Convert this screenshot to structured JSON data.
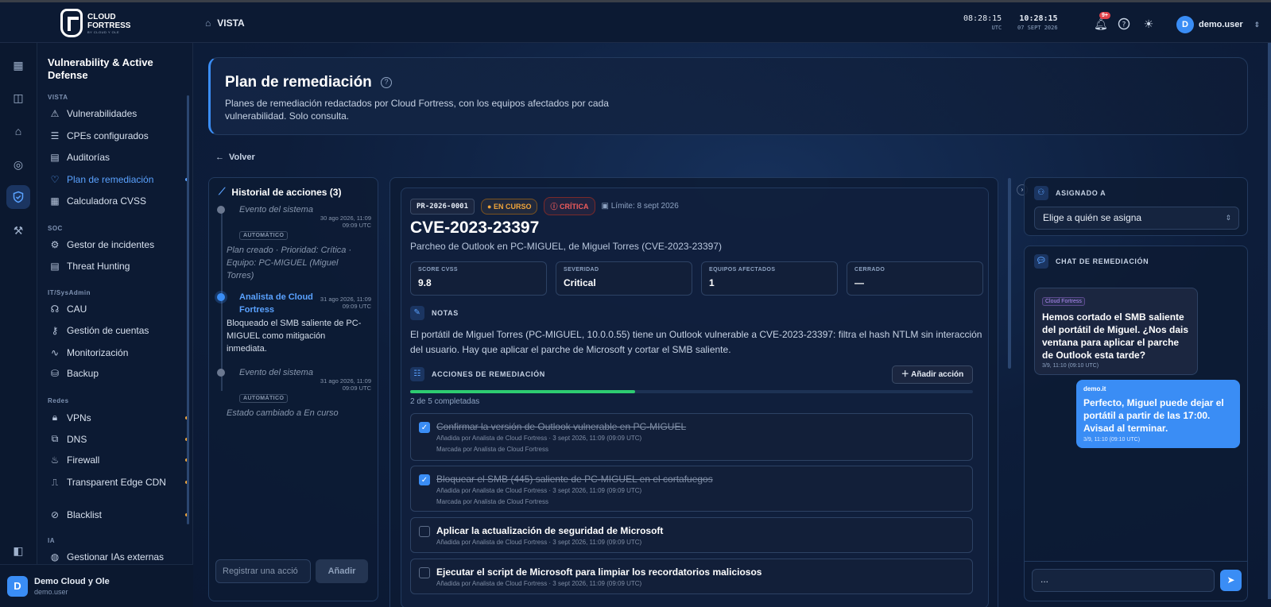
{
  "header": {
    "brand": "CLOUD FORTRESS",
    "brand_sub": "BY CLOUD Y OLE",
    "breadcrumb": "VISTA",
    "utc_time": "08:28:15",
    "utc_label": "UTC",
    "local_time": "10:28:15",
    "local_date": "07 SEPT 2026",
    "notif_badge": "9+",
    "username": "demo.user",
    "avatar_letter": "D"
  },
  "rail": {
    "icons": [
      "grid-icon",
      "robot-icon",
      "home-icon",
      "target-icon",
      "shield-icon",
      "tools-icon",
      "collapse-sidebar-icon"
    ]
  },
  "sidebar": {
    "title": "Vulnerability & Active Defense",
    "sections": {
      "vista": "VISTA",
      "soc": "SOC",
      "itsys": "IT/SysAdmin",
      "redes": "Redes",
      "ia": "IA"
    },
    "items": {
      "vulnerabilidades": "Vulnerabilidades",
      "cpes": "CPEs configurados",
      "auditorias": "Auditorías",
      "plan": "Plan de remediación",
      "cvss": "Calculadora CVSS",
      "incidentes": "Gestor de incidentes",
      "hunting": "Threat Hunting",
      "cau": "CAU",
      "cuentas": "Gestión de cuentas",
      "monitorizacion": "Monitorización",
      "backup": "Backup",
      "vpns": "VPNs",
      "dns": "DNS",
      "firewall": "Firewall",
      "cdn": "Transparent Edge CDN",
      "blacklist": "Blacklist",
      "ias": "Gestionar IAs externas"
    }
  },
  "footer_user": {
    "name": "Demo Cloud y Ole",
    "user": "demo.user",
    "avatar_letter": "D"
  },
  "hero": {
    "title": "Plan de remediación",
    "description": "Planes de remediación redactados por Cloud Fortress, con los equipos afectados por cada vulnerabilidad. Solo consulta."
  },
  "back_label": "Volver",
  "history": {
    "title": "Historial de acciones (3)",
    "events": [
      {
        "who": "Evento del sistema",
        "when1": "30 ago 2026, 11:09",
        "when2": "09:09 UTC",
        "tag": "AUTOMÁTICO",
        "body": "Plan creado · Prioridad: Crítica · Equipo: PC-MIGUEL (Miguel Torres)"
      },
      {
        "who": "Analista de Cloud Fortress",
        "when1": "31 ago 2026, 11:09",
        "when2": "09:09 UTC",
        "body": "Bloqueado el SMB saliente de PC-MIGUEL como mitigación inmediata."
      },
      {
        "who": "Evento del sistema",
        "when1": "31 ago 2026, 11:09",
        "when2": "09:09 UTC",
        "tag": "AUTOMÁTICO",
        "body": "Estado cambiado a En curso"
      }
    ],
    "input_placeholder": "Registrar una acció",
    "add_label": "Añadir"
  },
  "plan": {
    "id": "PR-2026-0001",
    "status": "EN CURSO",
    "severity_badge": "CRÍTICA",
    "limit": "Límite: 8 sept 2026",
    "cve": "CVE-2023-23397",
    "subtitle": "Parcheo de Outlook en PC-MIGUEL, de Miguel Torres (CVE-2023-23397)",
    "stats": [
      {
        "k": "SCORE CVSS",
        "v": "9.8"
      },
      {
        "k": "SEVERIDAD",
        "v": "Critical"
      },
      {
        "k": "EQUIPOS AFECTADOS",
        "v": "1"
      },
      {
        "k": "CERRADO",
        "v": "—"
      }
    ],
    "notes_title": "NOTAS",
    "notes": "El portátil de Miguel Torres (PC-MIGUEL, 10.0.0.55) tiene un Outlook vulnerable a CVE-2023-23397: filtra el hash NTLM sin interacción del usuario. Hay que aplicar el parche de Microsoft y cortar el SMB saliente.",
    "actions_title": "ACCIONES DE REMEDIACIÓN",
    "add_action": "Añadir acción",
    "progress_text": "2 de 5 completadas",
    "progress_fraction": 0.4,
    "tasks": [
      {
        "title": "Confirmar la versión de Outlook vulnerable en PC-MIGUEL",
        "meta": "Añadida por Analista de Cloud Fortress · 3 sept 2026, 11:09 (09:09 UTC)",
        "marked": "Marcada por Analista de Cloud Fortress",
        "done": true
      },
      {
        "title": "Bloquear el SMB (445) saliente de PC-MIGUEL en el cortafuegos",
        "meta": "Añadida por Analista de Cloud Fortress · 3 sept 2026, 11:09 (09:09 UTC)",
        "marked": "Marcada por Analista de Cloud Fortress",
        "done": true
      },
      {
        "title": "Aplicar la actualización de seguridad de Microsoft",
        "meta": "Añadida por Analista de Cloud Fortress · 3 sept 2026, 11:09 (09:09 UTC)",
        "done": false
      },
      {
        "title": "Ejecutar el script de Microsoft para limpiar los recordatorios maliciosos",
        "meta": "Añadida por Analista de Cloud Fortress · 3 sept 2026, 11:09 (09:09 UTC)",
        "done": false
      }
    ]
  },
  "assign": {
    "title": "ASIGNADO A",
    "placeholder": "Elige a quién se asigna"
  },
  "chat": {
    "title": "CHAT DE REMEDIACIÓN",
    "messages": [
      {
        "from": "Cloud Fortress",
        "text": "Hemos cortado el SMB saliente del portátil de Miguel. ¿Nos dais ventana para aplicar el parche de Outlook esta tarde?",
        "time": "3/9, 11:10 (09:10 UTC)"
      },
      {
        "from": "demo.it",
        "text": "Perfecto, Miguel puede dejar el portátil a partir de las 17:00. Avisad al terminar.",
        "time": "3/9, 11:10 (09:10 UTC)"
      }
    ],
    "input_placeholder": "..."
  },
  "colors": {
    "accent": "#3a8df5",
    "warning": "#f0a53a",
    "critical": "#ef5b5b",
    "success": "#2ecc71",
    "nav_dot": "#f0a53a"
  }
}
